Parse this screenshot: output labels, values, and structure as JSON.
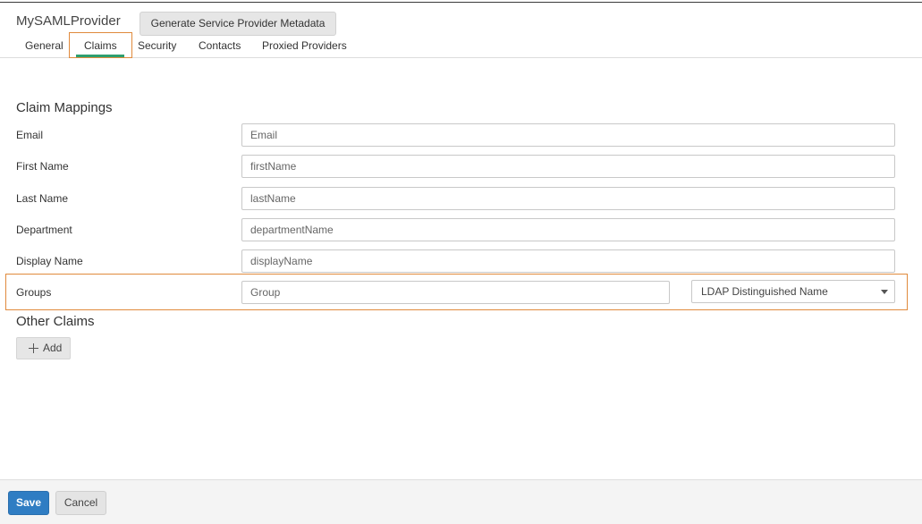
{
  "header": {
    "title": "MySAMLProvider",
    "generate_button": "Generate Service Provider Metadata"
  },
  "tabs": [
    {
      "label": "General"
    },
    {
      "label": "Claims"
    },
    {
      "label": "Security"
    },
    {
      "label": "Contacts"
    },
    {
      "label": "Proxied Providers"
    }
  ],
  "active_tab": "Claims",
  "claim_mappings": {
    "title": "Claim Mappings",
    "rows": [
      {
        "label": "Email",
        "value": "Email"
      },
      {
        "label": "First Name",
        "value": "firstName"
      },
      {
        "label": "Last Name",
        "value": "lastName"
      },
      {
        "label": "Department",
        "value": "departmentName"
      },
      {
        "label": "Display Name",
        "value": "displayName"
      },
      {
        "label": "Groups",
        "value": "Group",
        "format": "LDAP Distinguished Name"
      }
    ]
  },
  "other_claims": {
    "title": "Other Claims",
    "add_label": "Add"
  },
  "footer": {
    "save_label": "Save",
    "cancel_label": "Cancel"
  },
  "colors": {
    "accent_green": "#2e9e6e",
    "focus_orange": "#e08a3c",
    "primary_blue": "#2f7dc3"
  }
}
